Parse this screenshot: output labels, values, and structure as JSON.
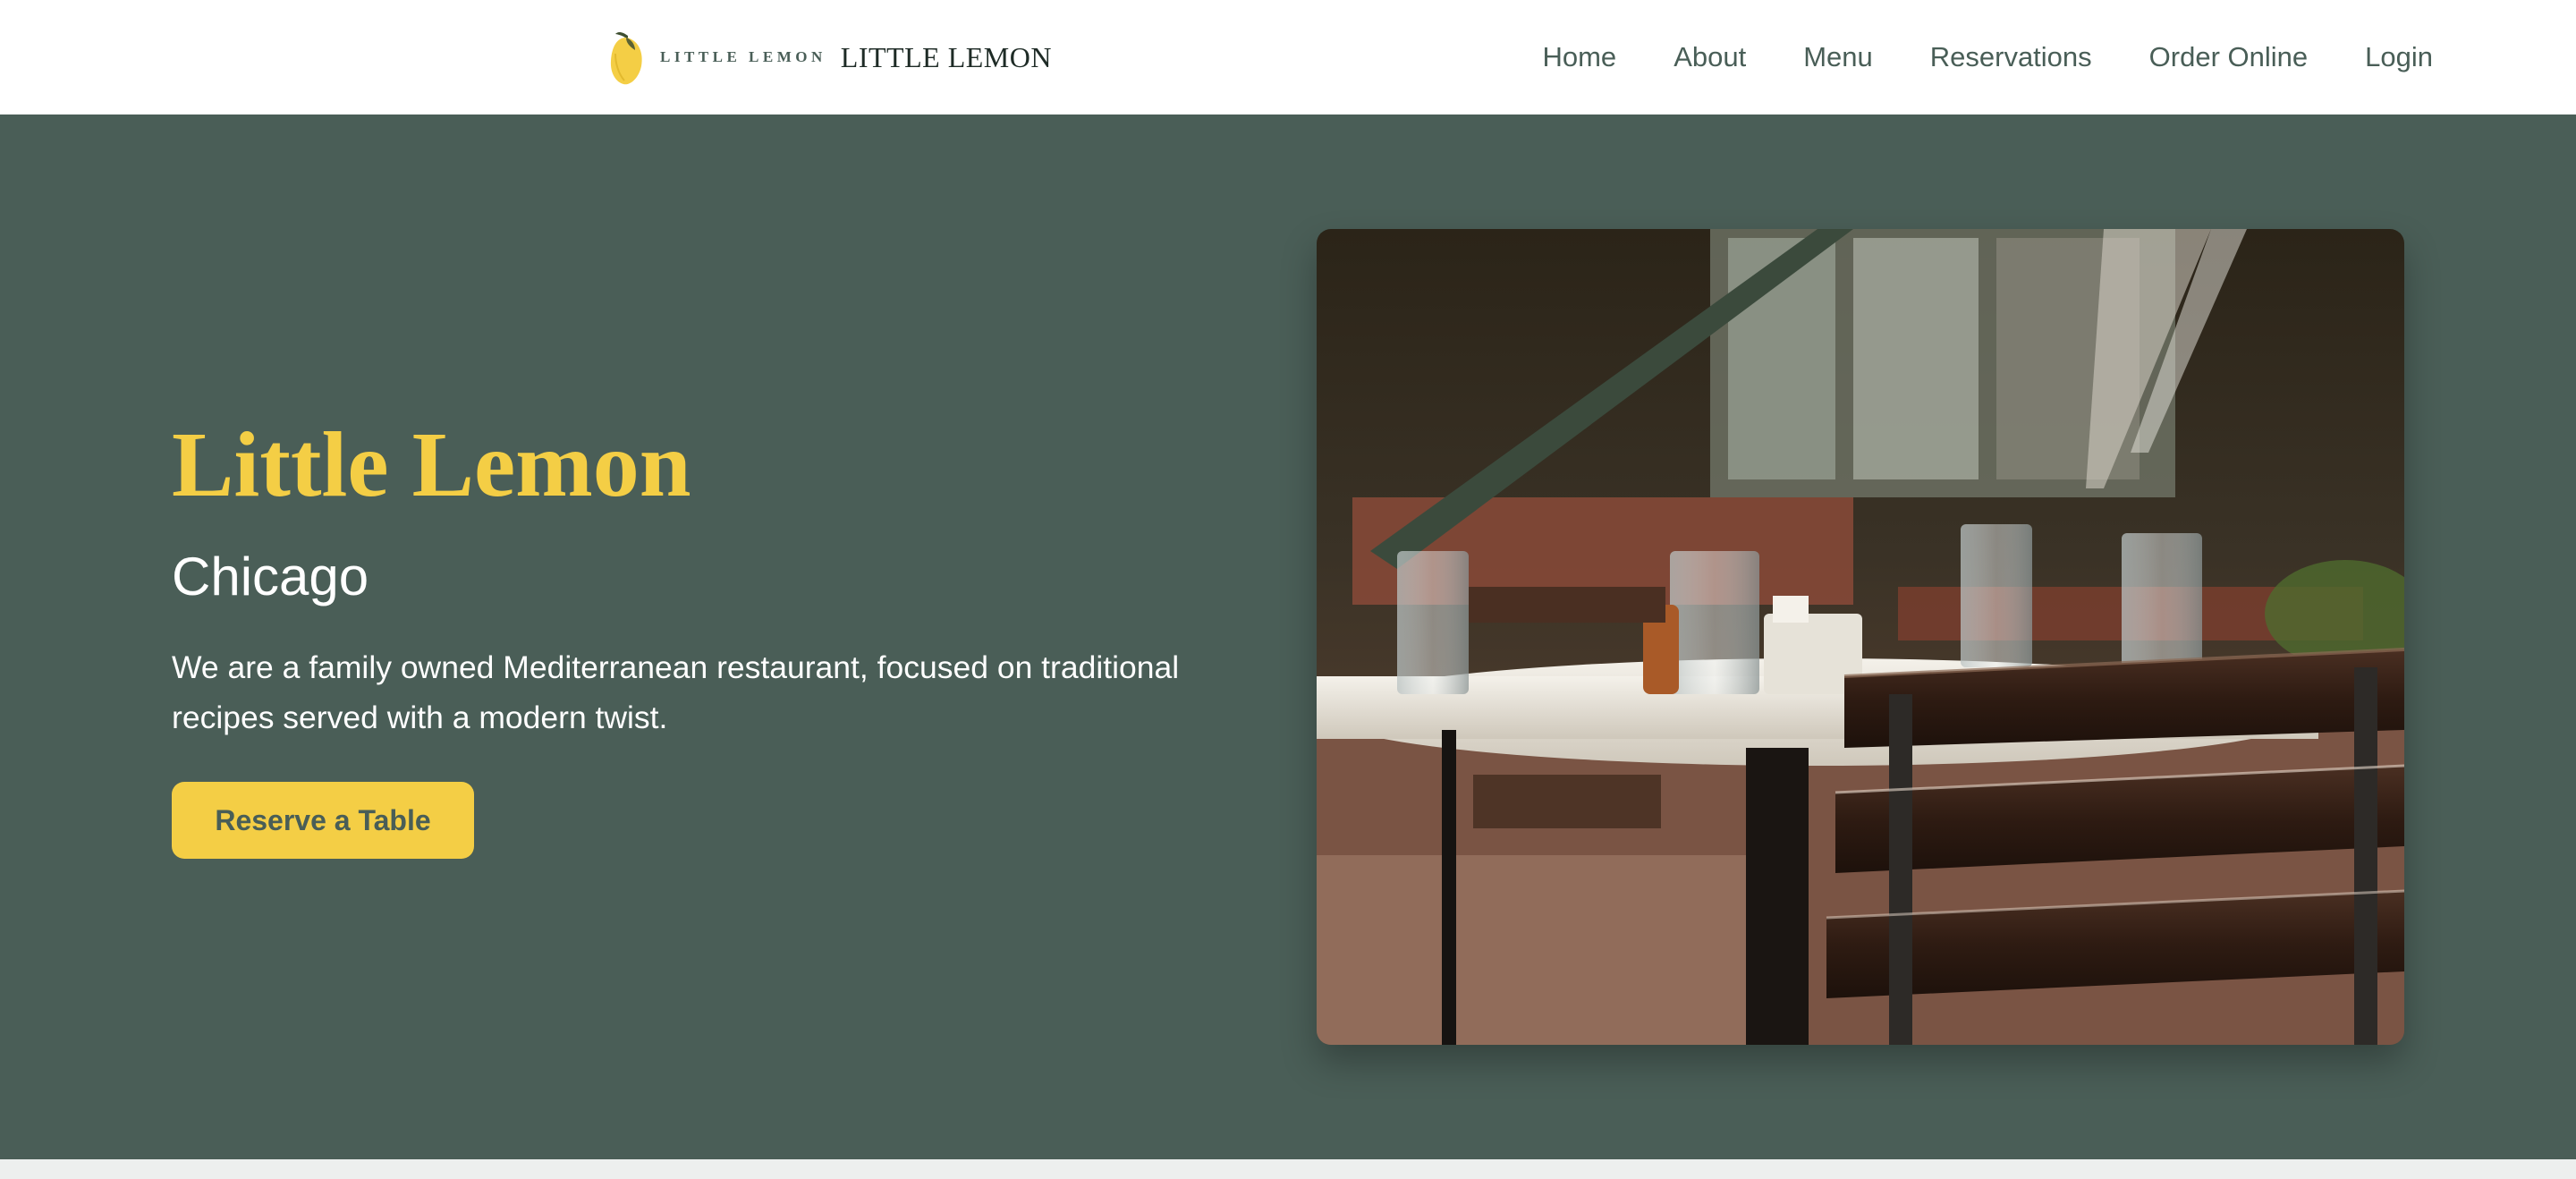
{
  "header": {
    "logo_small_text": "LITTLE LEMON",
    "logo_large_text": "LITTLE LEMON",
    "nav": [
      {
        "label": "Home"
      },
      {
        "label": "About"
      },
      {
        "label": "Menu"
      },
      {
        "label": "Reservations"
      },
      {
        "label": "Order Online"
      },
      {
        "label": "Login"
      }
    ]
  },
  "hero": {
    "title": "Little Lemon",
    "subtitle": "Chicago",
    "description": "We are a family owned Mediterranean restaurant, focused on traditional recipes served with a modern twist.",
    "cta_label": "Reserve a Table",
    "photo_alt": "restaurant-patio-table-photo"
  },
  "colors": {
    "primary_green": "#4A5E57",
    "accent_yellow": "#F4CE45",
    "nav_text": "#495E57",
    "header_bg": "#FFFFFF"
  }
}
